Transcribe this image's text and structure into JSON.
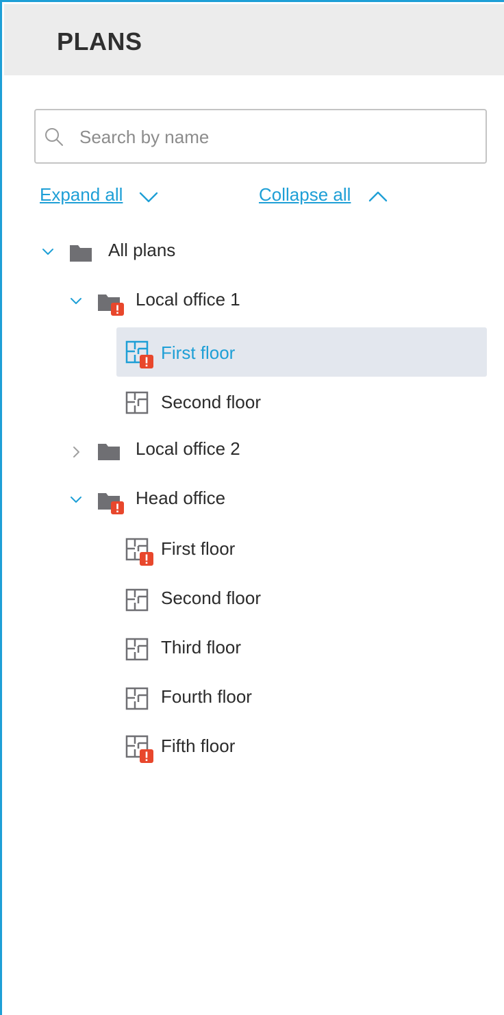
{
  "header": {
    "title": "PLANS"
  },
  "search": {
    "placeholder": "Search by name",
    "value": ""
  },
  "actions": {
    "expand_all": "Expand all",
    "collapse_all": "Collapse all"
  },
  "tree": {
    "root": {
      "label": "All plans",
      "expanded": true,
      "icon": "folder-icon"
    },
    "local_office_1": {
      "label": "Local office 1",
      "expanded": true,
      "alert": true,
      "icon": "folder-alert-icon",
      "children": [
        {
          "label": "First floor",
          "selected": true,
          "alert": true,
          "icon": "floor-plan-alert-icon"
        },
        {
          "label": "Second floor",
          "selected": false,
          "alert": false,
          "icon": "floor-plan-icon"
        }
      ]
    },
    "local_office_2": {
      "label": "Local office 2",
      "expanded": false,
      "alert": false,
      "icon": "folder-icon"
    },
    "head_office": {
      "label": "Head office",
      "expanded": true,
      "alert": true,
      "icon": "folder-alert-icon",
      "children": [
        {
          "label": "First floor",
          "alert": true,
          "icon": "floor-plan-alert-icon"
        },
        {
          "label": "Second floor",
          "alert": false,
          "icon": "floor-plan-icon"
        },
        {
          "label": "Third floor",
          "alert": false,
          "icon": "floor-plan-icon"
        },
        {
          "label": "Fourth floor",
          "alert": false,
          "icon": "floor-plan-icon"
        },
        {
          "label": "Fifth floor",
          "alert": true,
          "icon": "floor-plan-alert-icon"
        }
      ]
    }
  },
  "colors": {
    "accent": "#1e9fd6",
    "header_bg": "#ececec",
    "selected_bg": "#e3e7ee",
    "alert": "#e8472c",
    "folder": "#6f6f73"
  }
}
